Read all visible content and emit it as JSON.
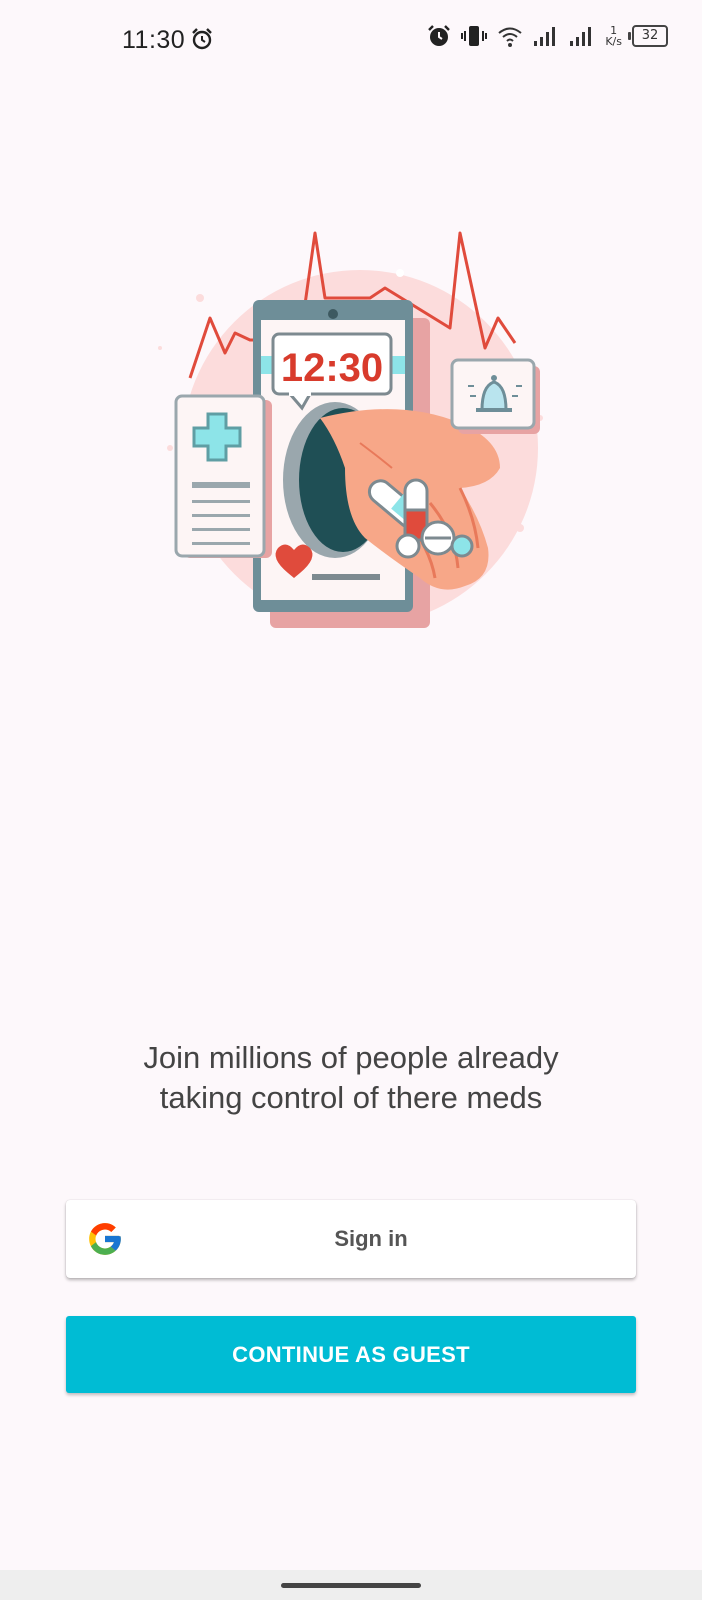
{
  "status_bar": {
    "time": "11:30",
    "network_speed_value": "1",
    "network_speed_unit": "K/s",
    "battery_level": "32",
    "icons": [
      "alarm-icon",
      "vibrate-icon",
      "wifi-icon",
      "signal-icon",
      "signal-icon",
      "battery-icon"
    ]
  },
  "illustration": {
    "clock_text": "12:30",
    "icons": [
      "medical-cross-icon",
      "bell-icon",
      "heart-icon",
      "pill-icon",
      "heartbeat-line"
    ]
  },
  "tagline": {
    "line1": "Join millions of people already",
    "line2": "taking control of there meds"
  },
  "signin": {
    "label": "Sign in",
    "icon": "google-icon"
  },
  "guest": {
    "label": "CONTINUE AS GUEST"
  },
  "colors": {
    "background": "#fdf8fb",
    "accent": "#00bcd4",
    "illustration_red": "#e04b3c",
    "illustration_teal": "#8de4e8"
  }
}
